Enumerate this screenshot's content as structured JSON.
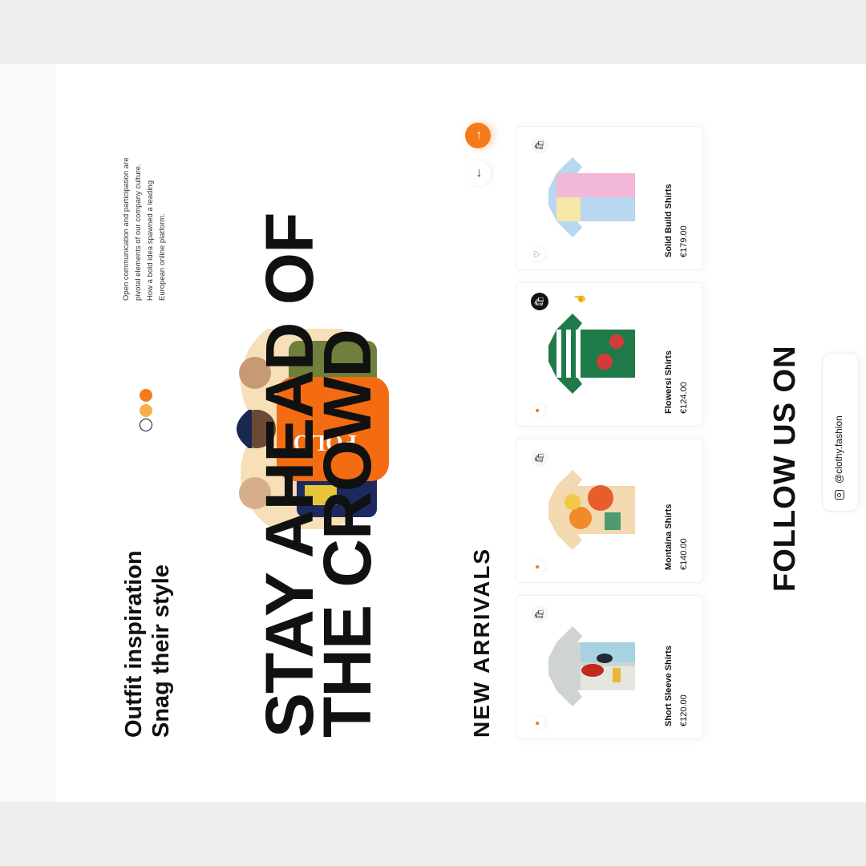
{
  "hero": {
    "tagline_line1": "Outfit inspiration",
    "tagline_line2": "Snag their style",
    "title_line1": "STAY AHEAD OF",
    "title_line2": "THE CROWD",
    "about": "Open communication and participation are pivotal elements of our company culture. How a bold idea spawned a leading European online platform."
  },
  "colors": {
    "accent": "#f47b1c",
    "dark": "#111111",
    "dot_1": "#111111",
    "dot_2": "#f5b04a",
    "dot_3": "#f47b1c"
  },
  "nav": {
    "up_icon": "arrow-up-icon",
    "down_icon": "arrow-down-icon"
  },
  "arrivals": {
    "title": "NEW ARRIVALS",
    "products": [
      {
        "name": "Short Sleeve Shirts",
        "price": "€120.00"
      },
      {
        "name": "Montaina Shirts",
        "price": "€140.00"
      },
      {
        "name": "Flowersi Shirts",
        "price": "€124.00"
      },
      {
        "name": "Solid Build Shirts",
        "price": "€179.00"
      }
    ]
  },
  "follow": {
    "title": "FOLLOW US ON",
    "handle": "@clothy.fashion"
  }
}
